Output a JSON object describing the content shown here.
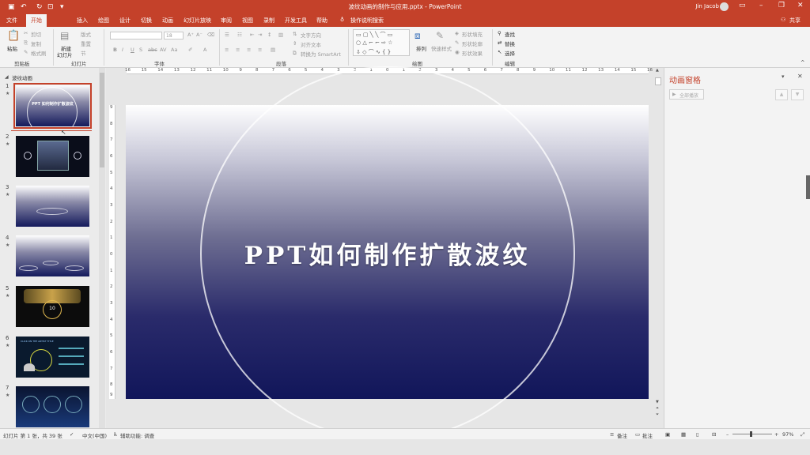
{
  "app": {
    "title": "波纹动画的制作与应用.pptx - PowerPoint",
    "user": "Jin Jacob",
    "quick_access": [
      "save-icon",
      "undo-icon",
      "redo-icon",
      "slideshow-icon"
    ],
    "window_controls": [
      "minimize-icon",
      "restore-icon",
      "close-icon"
    ]
  },
  "tabs": [
    {
      "label": "文件",
      "active": false
    },
    {
      "label": "开始",
      "active": true
    },
    {
      "label": "插入",
      "active": false
    },
    {
      "label": "绘图",
      "active": false
    },
    {
      "label": "设计",
      "active": false
    },
    {
      "label": "切换",
      "active": false
    },
    {
      "label": "动画",
      "active": false
    },
    {
      "label": "幻灯片放映",
      "active": false
    },
    {
      "label": "审阅",
      "active": false
    },
    {
      "label": "视图",
      "active": false
    },
    {
      "label": "录制",
      "active": false
    },
    {
      "label": "开发工具",
      "active": false
    },
    {
      "label": "帮助",
      "active": false
    }
  ],
  "tell_me": "操作说明搜索",
  "share": "共享",
  "ribbon": {
    "clipboard": {
      "label": "剪贴板",
      "paste": "粘贴",
      "cut": "剪切",
      "copy": "复制",
      "format_painter": "格式刷"
    },
    "slides": {
      "label": "幻灯片",
      "new_slide": "新建",
      "new_slide2": "幻灯片",
      "layout": "版式",
      "reset": "重置",
      "section": "节"
    },
    "font": {
      "label": "字体",
      "font_name": "",
      "font_size": "18"
    },
    "paragraph": {
      "label": "段落",
      "text_direction": "文字方向",
      "align_text": "对齐文本",
      "smartart": "转换为 SmartArt"
    },
    "drawing": {
      "label": "绘图",
      "arrange": "排列",
      "quick_styles": "快速样式",
      "fill": "形状填充",
      "outline": "形状轮廓",
      "effects": "形状效果"
    },
    "editing": {
      "label": "编辑",
      "find": "查找",
      "replace": "替换",
      "select": "选择"
    }
  },
  "thumbs": {
    "section": "波纹动画",
    "items": [
      {
        "num": "1",
        "title": "PPT 如何制作扩散波纹"
      },
      {
        "num": "2"
      },
      {
        "num": "3"
      },
      {
        "num": "4"
      },
      {
        "num": "5",
        "label": "10"
      },
      {
        "num": "6",
        "label": "CLICK ON THE ARTIST TITLE"
      },
      {
        "num": "7"
      }
    ]
  },
  "ruler": {
    "h": [
      "16",
      "15",
      "14",
      "13",
      "12",
      "11",
      "10",
      "9",
      "8",
      "7",
      "6",
      "5",
      "4",
      "3",
      "2",
      "1",
      "0",
      "1",
      "2",
      "3",
      "4",
      "5",
      "6",
      "7",
      "8",
      "9",
      "10",
      "11",
      "12",
      "13",
      "14",
      "15",
      "16"
    ],
    "v": [
      "9",
      "8",
      "7",
      "6",
      "5",
      "4",
      "3",
      "2",
      "1",
      "0",
      "1",
      "2",
      "3",
      "4",
      "5",
      "6",
      "7",
      "8",
      "9"
    ]
  },
  "slide": {
    "title": "PPT如何制作扩散波纹"
  },
  "anim_pane": {
    "title": "动画窗格",
    "play_all": "全部播放"
  },
  "status": {
    "slide_info": "幻灯片 第 1 张，共 39 张",
    "language": "中文(中国)",
    "accessibility": "辅助功能: 调查",
    "notes": "备注",
    "comments": "批注",
    "zoom": "97%"
  },
  "colors": {
    "accent": "#c4412a",
    "slide_top": "#ffffff",
    "slide_bottom": "#11165a"
  }
}
